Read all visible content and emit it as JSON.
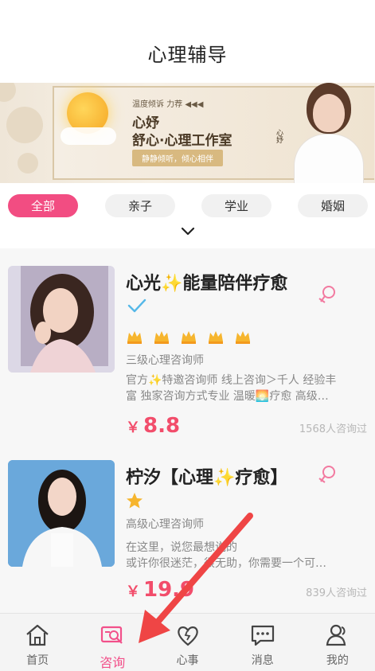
{
  "header": {
    "title": "心理辅导"
  },
  "banner": {
    "small_text": "温度倾诉 力荐 ◀◀◀",
    "brand": "心妤",
    "slogan": "舒心·心理工作室",
    "pill": "静静倾听，倾心相伴",
    "vertical": "心妤"
  },
  "filters": [
    {
      "label": "全部",
      "active": true
    },
    {
      "label": "亲子",
      "active": false
    },
    {
      "label": "学业",
      "active": false
    },
    {
      "label": "婚姻",
      "active": false
    }
  ],
  "counselors": [
    {
      "name": "心光✨能量陪伴疗愈",
      "verified": true,
      "stars": 5,
      "level": "三级心理咨询师",
      "desc_line1": "官方✨特邀咨询师 线上咨询＞千人 经验丰",
      "desc_line2": "富  独家咨询方式专业 温暖🌅疗愈 高级…",
      "price_symbol": "￥",
      "price": "8.8",
      "count": "1568人咨询过"
    },
    {
      "name": "柠汐【心理✨疗愈】",
      "verified": false,
      "stars": 1,
      "level": "高级心理咨询师",
      "desc_line1": "在这里，说您最想说的",
      "desc_line2": "或许你很迷茫，很无助，你需要一个可…",
      "price_symbol": "￥",
      "price": "19.9",
      "count": "839人咨询过"
    }
  ],
  "tabbar": [
    {
      "label": "首页",
      "icon": "home-icon",
      "active": false
    },
    {
      "label": "咨询",
      "icon": "consult-icon",
      "active": true
    },
    {
      "label": "心事",
      "icon": "heart-icon",
      "active": false
    },
    {
      "label": "消息",
      "icon": "message-icon",
      "active": false
    },
    {
      "label": "我的",
      "icon": "profile-icon",
      "active": false
    }
  ],
  "colors": {
    "accent": "#f24d82",
    "price": "#f24d6b",
    "annotation_arrow": "#ef4545"
  }
}
